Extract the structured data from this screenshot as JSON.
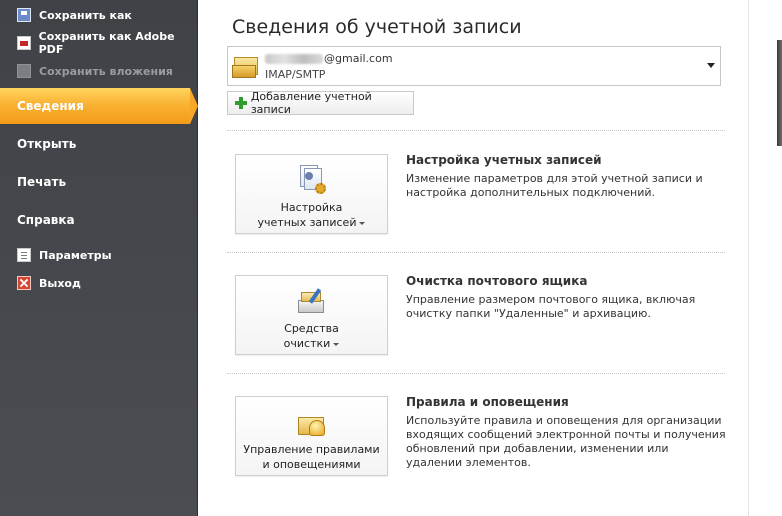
{
  "nav": {
    "save_as": "Сохранить как",
    "save_as_pdf": "Сохранить как Adobe PDF",
    "save_attachments": "Сохранить вложения",
    "info": "Сведения",
    "open": "Открыть",
    "print": "Печать",
    "help": "Справка",
    "options": "Параметры",
    "exit": "Выход"
  },
  "main": {
    "title": "Сведения об учетной записи",
    "account": {
      "email_suffix": "@gmail.com",
      "type": "IMAP/SMTP"
    },
    "add_account_label": "Добавление учетной записи",
    "sections": [
      {
        "button_line1": "Настройка",
        "button_line2": "учетных записей",
        "title": "Настройка учетных записей",
        "description": "Изменение параметров для этой учетной записи и настройка дополнительных подключений."
      },
      {
        "button_line1": "Средства",
        "button_line2": "очистки",
        "title": "Очистка почтового ящика",
        "description": "Управление размером почтового ящика, включая очистку папки \"Удаленные\" и архивацию."
      },
      {
        "button_line1": "Управление правилами",
        "button_line2": "и оповещениями",
        "title": "Правила и оповещения",
        "description": "Используйте правила и оповещения для организации входящих сообщений электронной почты и получения обновлений при добавлении, изменении или удалении элементов."
      }
    ]
  },
  "colors": {
    "nav_bg": "#45484c",
    "active_accent": "#f7a625"
  }
}
